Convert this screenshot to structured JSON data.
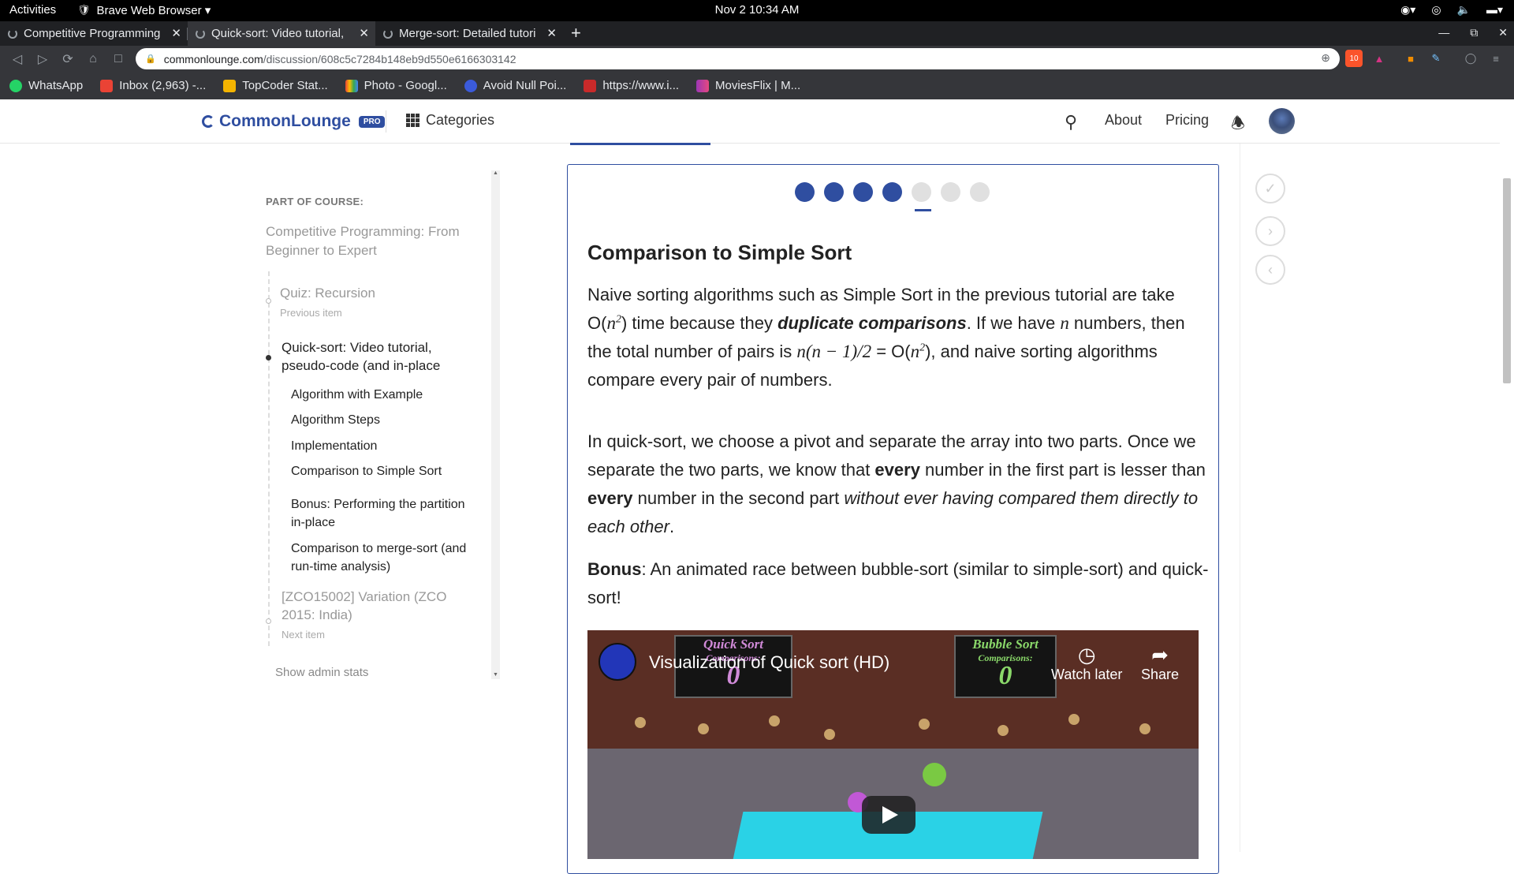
{
  "os": {
    "activities": "Activities",
    "app_name": "Brave Web Browser ▾",
    "clock": "Nov 2  10:34 AM"
  },
  "browser": {
    "tabs": [
      {
        "title": "Competitive Programming"
      },
      {
        "title": "Quick-sort: Video tutorial,"
      },
      {
        "title": "Merge-sort: Detailed tutori"
      }
    ],
    "url_domain": "commonlounge.com",
    "url_path": "/discussion/608c5c7284b148eb9d550e6166303142",
    "shield_badge": "10",
    "bookmarks": [
      {
        "label": "WhatsApp",
        "color": "#25d366"
      },
      {
        "label": "Inbox (2,963) -...",
        "color": "#ea4335"
      },
      {
        "label": "TopCoder Stat...",
        "color": "#f4b400"
      },
      {
        "label": "Photo - Googl...",
        "color": "#fbbc05"
      },
      {
        "label": "Avoid Null Poi...",
        "color": "#3b5bdb"
      },
      {
        "label": "https://www.i...",
        "color": "#c92a2a"
      },
      {
        "label": "MoviesFlix | M...",
        "color": "#9c36b5"
      }
    ]
  },
  "site": {
    "logo": "CommonLounge",
    "pro": "PRO",
    "categories": "Categories",
    "about": "About",
    "pricing": "Pricing"
  },
  "sidebar": {
    "part_label": "PART OF COURSE:",
    "course": "Competitive Programming: From Beginner to Expert",
    "prev_title": "Quiz: Recursion",
    "prev_label": "Previous item",
    "current_title": "Quick-sort: Video tutorial, pseudo-code (and in-place",
    "sections": [
      "Algorithm with Example",
      "Algorithm Steps",
      "Implementation",
      "Comparison to Simple Sort",
      "Bonus: Performing the partition in-place",
      "Comparison to merge-sort (and run-time analysis)"
    ],
    "next_title": "[ZCO15002] Variation (ZCO 2015: India)",
    "next_label": "Next item",
    "admin": "Show admin stats"
  },
  "progress": {
    "total": 7,
    "completed": 4,
    "current": 5
  },
  "article": {
    "heading": "Comparison to Simple Sort",
    "p1_a": "Naive sorting algorithms such as Simple Sort in the previous tutorial are take O(",
    "p1_b": ") time because they ",
    "p1_em": "duplicate comparisons",
    "p1_c": ". If we have ",
    "p1_d": " numbers, then the total number of pairs is ",
    "p1_e": " = O(",
    "p1_f": "), and naive sorting algorithms compare every pair of numbers.",
    "math_n": "n",
    "math_sq": "2",
    "math_pairs": "n(n − 1)/2",
    "p2_a": "In quick-sort, we choose a pivot and separate the array into two parts. Once we separate the two parts, we know that ",
    "p2_b1": "every",
    "p2_c": " number in the first part is lesser than ",
    "p2_b2": "every",
    "p2_d": " number in the second part ",
    "p2_em": "without ever having compared them directly to each other",
    "p2_e": ".",
    "p3_b": "Bonus",
    "p3_a": ": An animated race between bubble-sort (similar to simple-sort) and quick-sort!"
  },
  "video": {
    "title": "Visualization of Quick sort (HD)",
    "watch_later": "Watch later",
    "share": "Share",
    "board1_title": "Quick Sort",
    "board1_sub": "Comparisons:",
    "board1_value": "0",
    "board2_title": "Bubble Sort",
    "board2_sub": "Comparisons:",
    "board2_value": "0"
  }
}
